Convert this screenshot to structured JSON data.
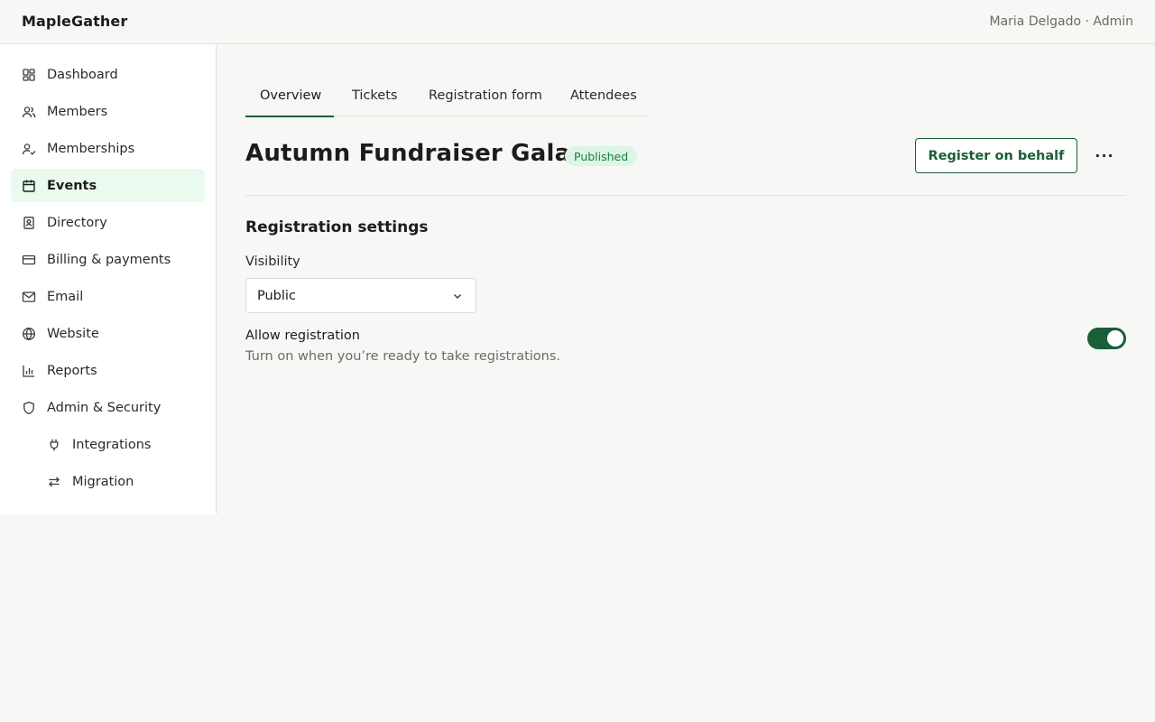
{
  "app": {
    "brand": "MapleGather",
    "user": "Maria Delgado · Admin"
  },
  "sidebar": {
    "items": [
      {
        "label": "Dashboard",
        "icon": "dashboard-icon"
      },
      {
        "label": "Members",
        "icon": "members-icon"
      },
      {
        "label": "Memberships",
        "icon": "memberships-icon"
      },
      {
        "label": "Events",
        "icon": "calendar-icon",
        "active": true
      },
      {
        "label": "Directory",
        "icon": "directory-icon"
      },
      {
        "label": "Billing & payments",
        "icon": "credit-card-icon"
      },
      {
        "label": "Email",
        "icon": "mail-icon"
      },
      {
        "label": "Website",
        "icon": "globe-icon"
      },
      {
        "label": "Reports",
        "icon": "bar-chart-icon"
      },
      {
        "label": "Admin & Security",
        "icon": "shield-icon"
      },
      {
        "label": "Integrations",
        "icon": "plug-icon"
      },
      {
        "label": "Migration",
        "icon": "arrows-swap-icon"
      }
    ]
  },
  "tabs": [
    {
      "label": "Overview",
      "active": true
    },
    {
      "label": "Tickets"
    },
    {
      "label": "Registration form"
    },
    {
      "label": "Attendees"
    }
  ],
  "event": {
    "title": "Autumn Fundraiser Gala",
    "status": "Published",
    "register_button": "Register on behalf",
    "more_label": "···"
  },
  "settings": {
    "section_title": "Registration settings",
    "visibility_label": "Visibility",
    "visibility_value": "Public",
    "allow_label": "Allow registration",
    "allow_help": "Turn on when you’re ready to take registrations.",
    "allow_enabled": true
  },
  "colors": {
    "accent": "#1b5e3a",
    "active_nav_bg": "#eafaef",
    "badge_bg": "#dcf5e5",
    "badge_text": "#1b7a45"
  }
}
